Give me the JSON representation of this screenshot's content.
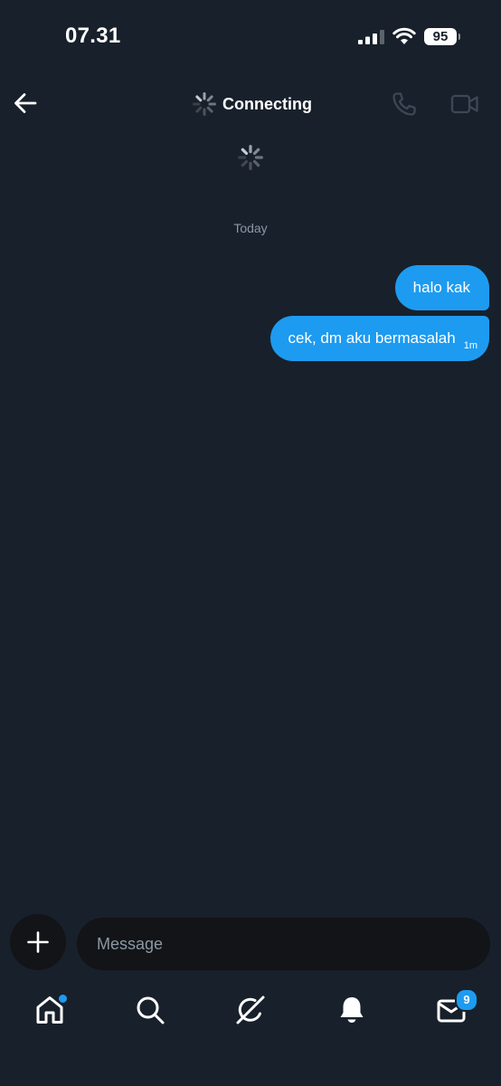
{
  "status_bar": {
    "time": "07.31",
    "battery": "95"
  },
  "header": {
    "title": "Connecting",
    "icons": {
      "back": "arrow-left-icon",
      "call": "phone-icon",
      "video": "video-icon",
      "spinner": "spinner-icon"
    }
  },
  "conversation": {
    "date_separator": "Today",
    "messages": [
      {
        "text": "halo kak",
        "time": ""
      },
      {
        "text": "cek, dm aku bermasalah",
        "time": "1m"
      }
    ]
  },
  "composer": {
    "placeholder": "Message"
  },
  "bottom_nav": {
    "items": [
      {
        "icon": "home-icon",
        "has_dot": true
      },
      {
        "icon": "search-icon"
      },
      {
        "icon": "grok-icon"
      },
      {
        "icon": "bell-icon"
      },
      {
        "icon": "mail-icon",
        "badge": "9"
      }
    ]
  },
  "colors": {
    "background": "#18202b",
    "accent": "#1d9bf0",
    "input_bg": "#121417",
    "muted_text": "#8b98a5"
  }
}
